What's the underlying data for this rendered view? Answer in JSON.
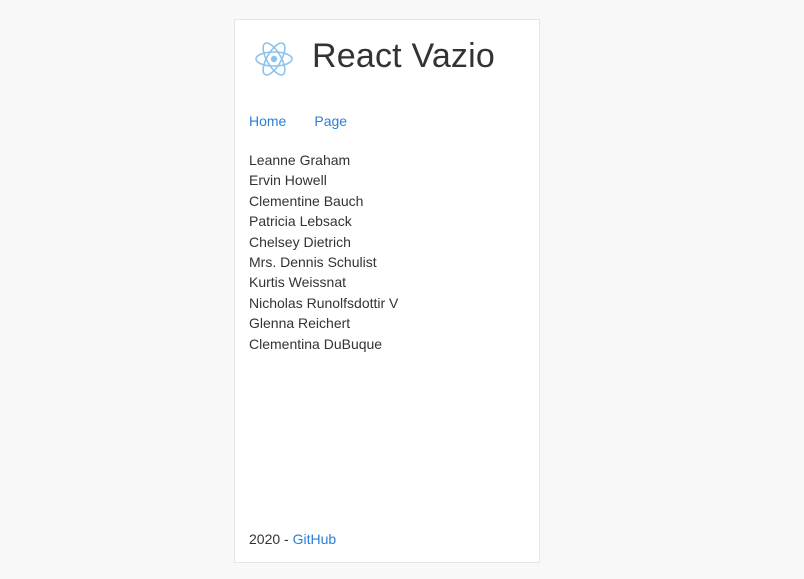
{
  "header": {
    "title": "React Vazio",
    "logo_icon": "react-atom-icon",
    "logo_color": "#8cc3ec"
  },
  "nav": {
    "items": [
      {
        "label": "Home"
      },
      {
        "label": "Page"
      }
    ],
    "link_color": "#2b7fd8"
  },
  "users": [
    "Leanne Graham",
    "Ervin Howell",
    "Clementine Bauch",
    "Patricia Lebsack",
    "Chelsey Dietrich",
    "Mrs. Dennis Schulist",
    "Kurtis Weissnat",
    "Nicholas Runolfsdottir V",
    "Glenna Reichert",
    "Clementina DuBuque"
  ],
  "footer": {
    "year_prefix": "2020 - ",
    "link_label": "GitHub"
  }
}
